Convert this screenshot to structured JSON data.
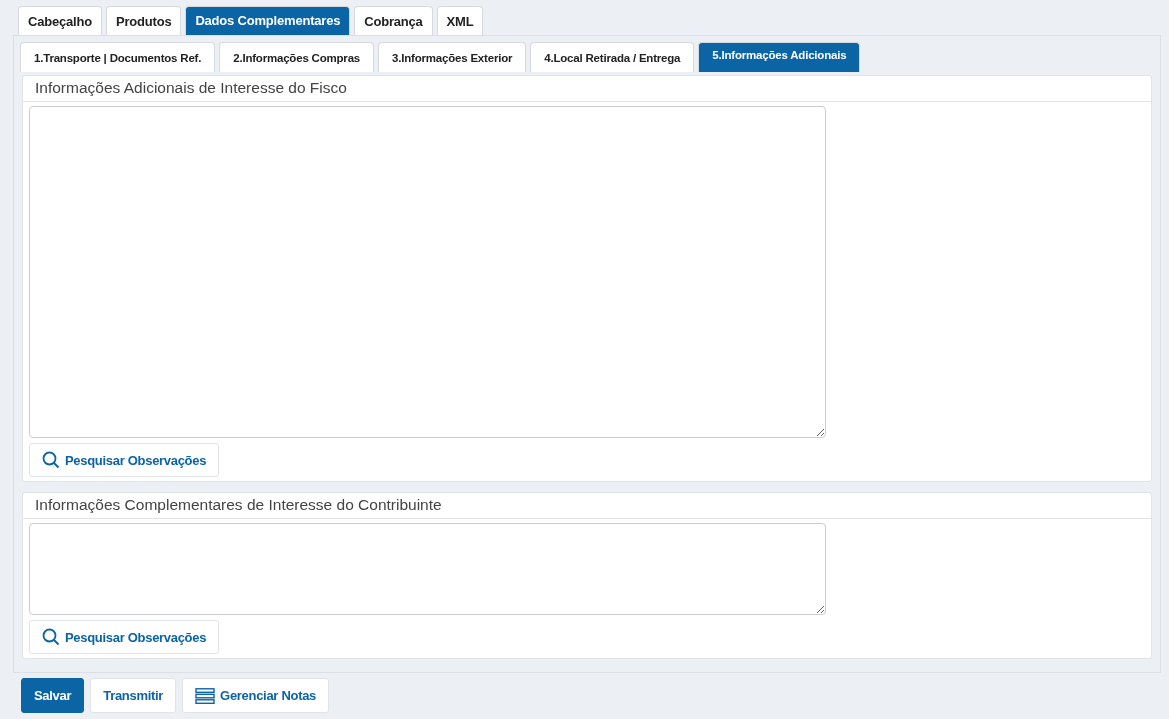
{
  "main_tabs": [
    {
      "label": "Cabeçalho",
      "selected": false
    },
    {
      "label": "Produtos",
      "selected": false
    },
    {
      "label": "Dados Complementares",
      "selected": true
    },
    {
      "label": "Cobrança",
      "selected": false
    },
    {
      "label": "XML",
      "selected": false
    }
  ],
  "sub_tabs": [
    {
      "label": "1.Transporte | Documentos Ref.",
      "selected": false
    },
    {
      "label": "2.Informações Compras",
      "selected": false
    },
    {
      "label": "3.Informações Exterior",
      "selected": false
    },
    {
      "label": "4.Local Retirada / Entrega",
      "selected": false
    },
    {
      "label": "5.Informações Adicionais",
      "selected": true
    }
  ],
  "sections": [
    {
      "title": "Informações Adicionais de Interesse do Fisco",
      "search_button": "Pesquisar Observações"
    },
    {
      "title": "Informações Complementares de Interesse do Contribuinte",
      "search_button": "Pesquisar Observações"
    }
  ],
  "footer_buttons": [
    {
      "label": "Salvar",
      "kind": "primary"
    },
    {
      "label": "Transmitir",
      "kind": "plain"
    },
    {
      "label": "Gerenciar Notas",
      "kind": "icon"
    }
  ]
}
